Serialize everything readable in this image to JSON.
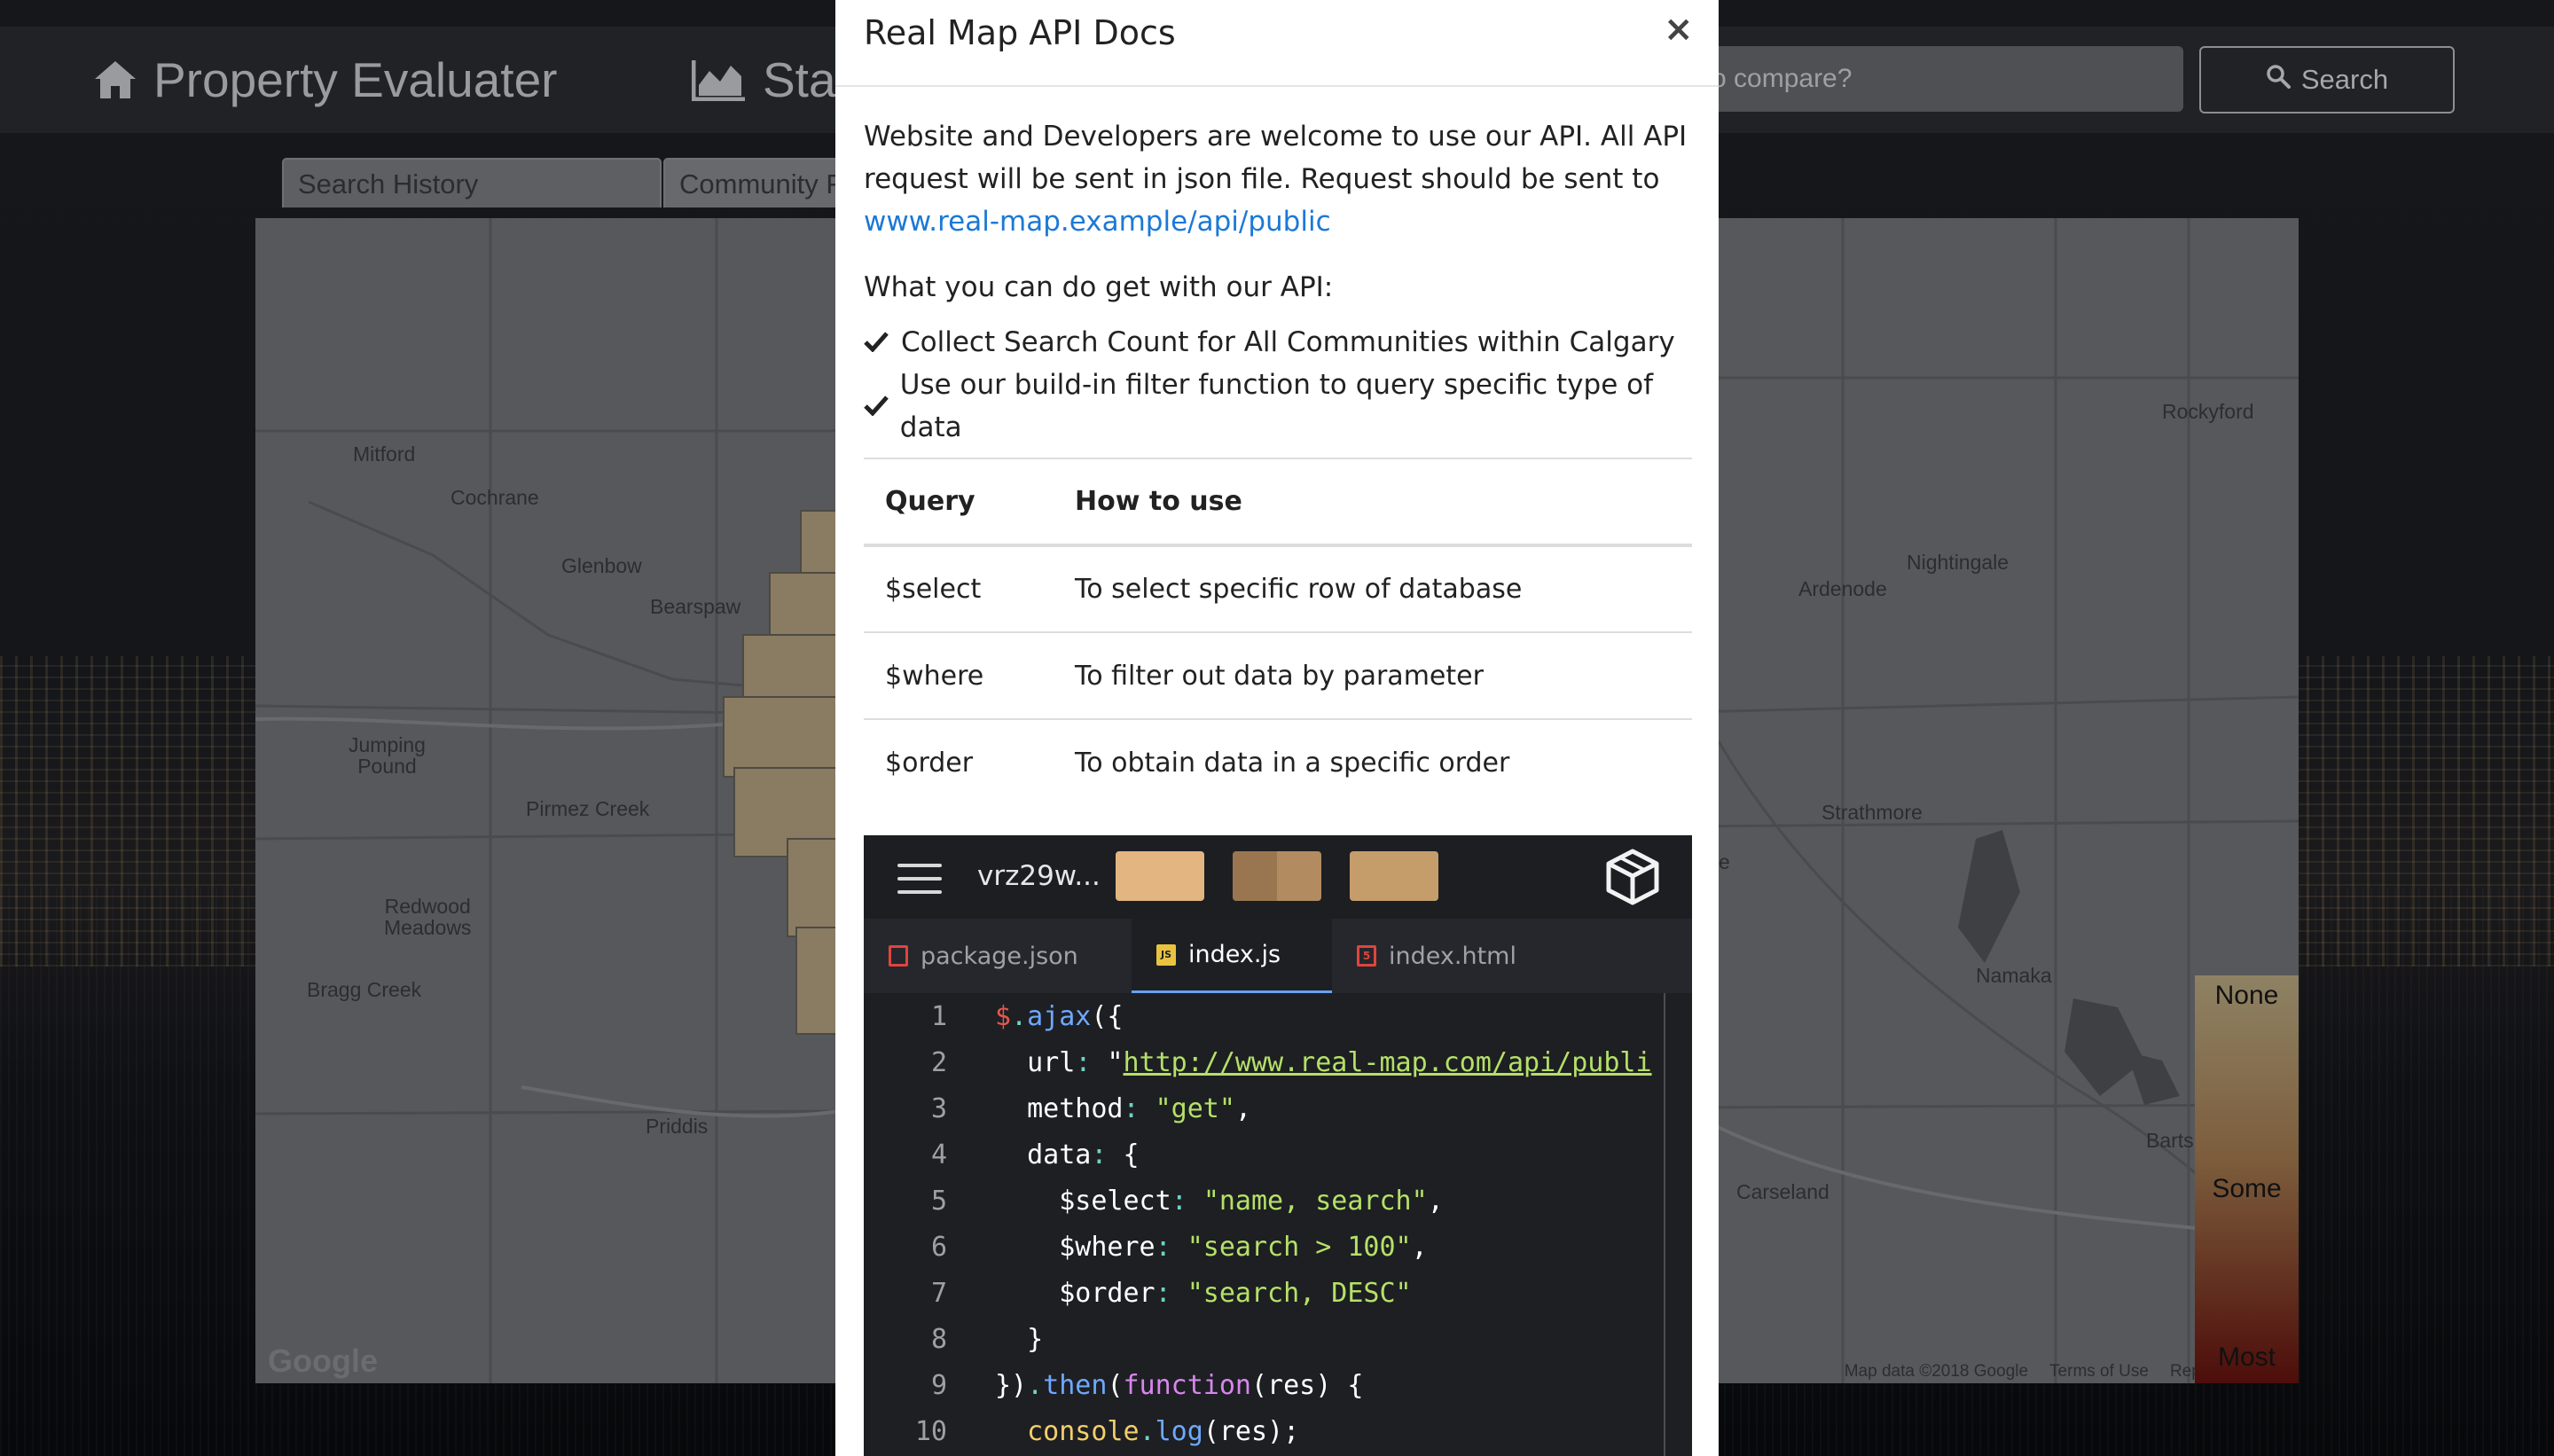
{
  "app": {
    "brand_title": "Property Evaluater",
    "nav_stats_label": "Sta",
    "search_placeholder": "o compare?",
    "search_button_label": "Search",
    "tabs": [
      {
        "label": "Search History"
      },
      {
        "label": "Community F"
      }
    ]
  },
  "map": {
    "places": [
      {
        "name": "Mitford"
      },
      {
        "name": "Cochrane"
      },
      {
        "name": "Glenbow"
      },
      {
        "name": "Bearspaw"
      },
      {
        "name": "Jumping\nPound"
      },
      {
        "name": "Pirmez Creek"
      },
      {
        "name": "Redwood\nMeadows"
      },
      {
        "name": "Bragg Creek"
      },
      {
        "name": "Priddis"
      },
      {
        "name": "Rockyford"
      },
      {
        "name": "Nightingale"
      },
      {
        "name": "Ardenode"
      },
      {
        "name": "Strathmore"
      },
      {
        "name": "Namaka"
      },
      {
        "name": "Barts"
      },
      {
        "name": "Carseland"
      },
      {
        "name": "e"
      }
    ],
    "google_logo": "Google",
    "map_data": "Map data ©2018 Google",
    "terms": "Terms of Use",
    "report": "Report",
    "legend": {
      "none": "None",
      "some": "Some",
      "most": "Most"
    }
  },
  "modal": {
    "title": "Real Map API Docs",
    "close_label": "×",
    "intro_text": "Website and Developers are welcome to use our API. All API request will be sent in json file. Request should be sent to",
    "api_link": "www.real-map.example/api/public",
    "can_do_heading": "What you can do get with our API:",
    "features": [
      "Collect Search Count for All Communities within Calgary",
      "Use our build-in filter function to query specific type of data"
    ],
    "table": {
      "headers": [
        "Query",
        "How to use"
      ],
      "rows": [
        [
          "$select",
          "To select specific row of database"
        ],
        [
          "$where",
          "To filter out data by parameter"
        ],
        [
          "$order",
          "To obtain data in a specific order"
        ]
      ]
    }
  },
  "embed": {
    "sandbox_name": "vrz29w...",
    "swatch_colors": [
      "#e2b581",
      "#9a7650",
      "#b28b61",
      "#c59d6b"
    ],
    "files": [
      {
        "name": "package.json",
        "icon": "npm-icon"
      },
      {
        "name": "index.js",
        "icon": "js-icon",
        "active": true
      },
      {
        "name": "index.html",
        "icon": "html5-icon"
      }
    ],
    "line_numbers": [
      "1",
      "2",
      "3",
      "4",
      "5",
      "6",
      "7",
      "8",
      "9",
      "10"
    ],
    "code": {
      "l1_dollar": "$",
      "l1_dot": ".",
      "l1_fn": "ajax",
      "l1_rest": "({",
      "l2_key": "  url",
      "l2_colon": ": ",
      "l2_q": "\"",
      "l2_url": "http://www.real-map.com/api/publi",
      "l3_key": "  method",
      "l3_colon": ": ",
      "l3_str": "\"get\"",
      "l3_end": ",",
      "l4_key": "  data",
      "l4_colon": ": ",
      "l4_end": "{",
      "l5_key": "    $select",
      "l5_colon": ": ",
      "l5_str": "\"name, search\"",
      "l5_end": ",",
      "l6_key": "    $where",
      "l6_colon": ": ",
      "l6_str": "\"search > 100\"",
      "l6_end": ",",
      "l7_key": "    $order",
      "l7_colon": ": ",
      "l7_str": "\"search, DESC\"",
      "l8": "  }",
      "l9_a": "})",
      "l9_dot": ".",
      "l9_fn": "then",
      "l9_b": "(",
      "l9_kw": "function",
      "l9_c": "(res) {",
      "l10_obj": "  console",
      "l10_dot": ".",
      "l10_fn": "log",
      "l10_rest": "(res);"
    }
  },
  "colors": {
    "link": "#1b79d6",
    "code_bg": "#1d1f23",
    "string": "#b5e067",
    "function": "#6fa8ff",
    "keyword": "#d786ec"
  }
}
